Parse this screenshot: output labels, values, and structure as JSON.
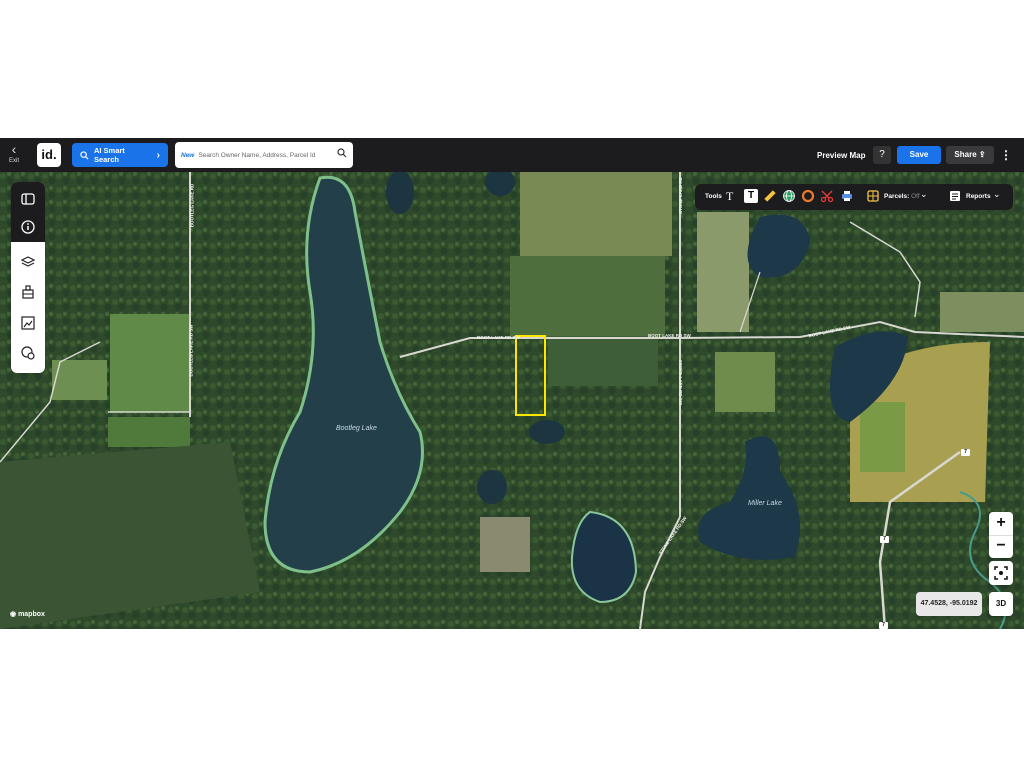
{
  "topbar": {
    "exit_label": "Exit",
    "logo": "id.",
    "ai_search_label": "AI Smart Search",
    "search_new_tag": "New",
    "search_placeholder": "Search Owner Name, Address, Parcel Id",
    "preview_map_label": "Preview Map",
    "help_label": "?",
    "save_label": "Save",
    "share_label": "Share"
  },
  "toolbar": {
    "tools_label": "Tools",
    "parcels_label": "Parcels:",
    "parcels_state": "Off",
    "reports_label": "Reports"
  },
  "sidebar": {
    "items": [
      "panel-toggle-icon",
      "info-icon",
      "layers-icon",
      "buildings-icon",
      "image-icon",
      "location-settings-icon"
    ]
  },
  "map": {
    "labels": {
      "bootleg_lake": "Bootleg Lake",
      "miller_lake": "Miller Lake"
    },
    "roads": {
      "bootleg_lake_rd_1": "BOOTLEG LAKE RD",
      "bootleg_lake_rd_2": "BOOTLEG LAKE RD SW",
      "boot_lake_rd_1": "BOOT LAKE RD SW",
      "boot_lake_rd_2": "BOOT LAKE RD SW",
      "boot_lake_rd_3": "BOOT LAKE RD SW",
      "stone_lake_rd_1": "STONE LAKE RD",
      "stone_lake_rd_2": "STONE LAKE RD SW",
      "stone_lake_rd_3": "STONE LAKE RD SW"
    },
    "highway_shield": "7",
    "coordinates": "47.4528, -95.0192",
    "attribution": "mapbox",
    "highlight_color": "#ffe600"
  },
  "controls": {
    "zoom_in": "+",
    "zoom_out": "−",
    "three_d": "3D"
  }
}
